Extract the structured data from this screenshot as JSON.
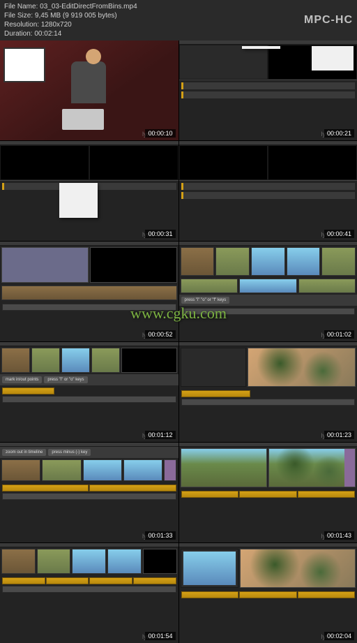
{
  "header": {
    "file_name_label": "File Name:",
    "file_name": "03_03-EditDirectFromBins.mp4",
    "file_size_label": "File Size:",
    "file_size": "9,45 MB (9 919 005 bytes)",
    "resolution_label": "Resolution:",
    "resolution": "1280x720",
    "duration_label": "Duration:",
    "duration": "00:02:14",
    "app_name": "MPC-HC"
  },
  "watermark": "www.cgku.com",
  "thumbs": [
    {
      "timestamp": "00:00:10",
      "brand": "lynd"
    },
    {
      "timestamp": "00:00:21",
      "brand": "lynd"
    },
    {
      "timestamp": "00:00:31",
      "brand": "lynd"
    },
    {
      "timestamp": "00:00:41",
      "brand": "lynd"
    },
    {
      "timestamp": "00:00:52",
      "brand": "lynd"
    },
    {
      "timestamp": "00:01:02",
      "brand": "lynd"
    },
    {
      "timestamp": "00:01:12",
      "brand": "lynd"
    },
    {
      "timestamp": "00:01:23",
      "brand": "lynd"
    },
    {
      "timestamp": "00:01:33",
      "brand": "lynd"
    },
    {
      "timestamp": "00:01:43",
      "brand": "lynd"
    },
    {
      "timestamp": "00:01:54",
      "brand": "lynd"
    },
    {
      "timestamp": "00:02:04",
      "brand": "lynd"
    }
  ],
  "hints": {
    "mark_points": "mark in/out points",
    "press_io": "press \"i\" or \"o\" keys",
    "zoom_out": "zoom out in timeline",
    "press_minus": "press minus (-) key"
  }
}
